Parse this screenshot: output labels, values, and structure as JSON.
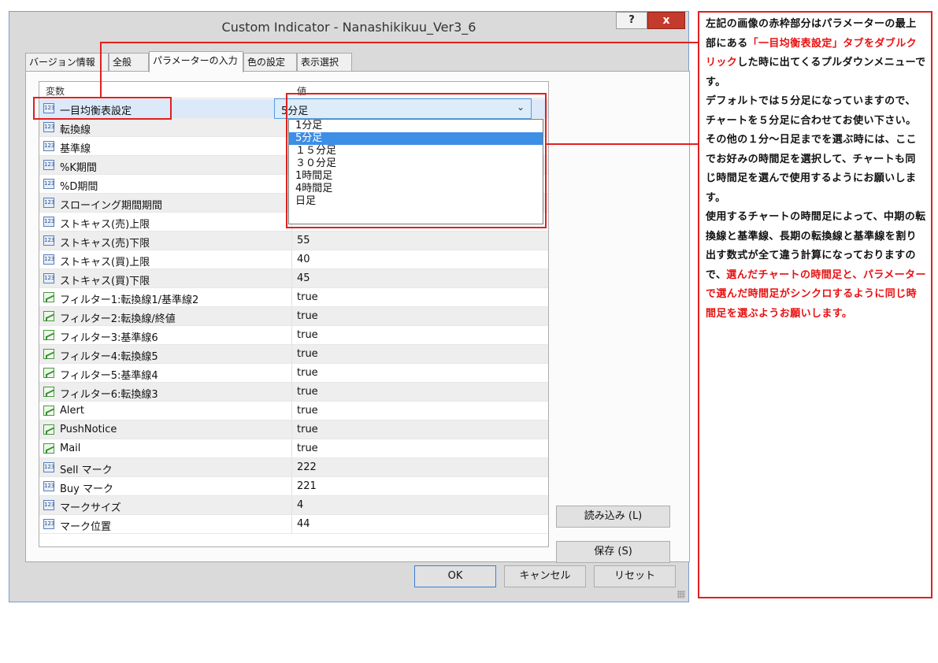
{
  "window": {
    "title": "Custom Indicator - Nanashikikuu_Ver3_6",
    "help_label": "?",
    "close_label": "x"
  },
  "tabs": [
    {
      "label": "バージョン情報"
    },
    {
      "label": "全般"
    },
    {
      "label": "パラメーターの入力"
    },
    {
      "label": "色の設定"
    },
    {
      "label": "表示選択"
    }
  ],
  "grid": {
    "col_name": "変数",
    "col_value": "値",
    "rows": [
      {
        "name": "一目均衡表設定",
        "value": "5分足",
        "type": "num"
      },
      {
        "name": "転換線",
        "value": "",
        "type": "num"
      },
      {
        "name": "基準線",
        "value": "",
        "type": "num"
      },
      {
        "name": "%K期間",
        "value": "",
        "type": "num"
      },
      {
        "name": "%D期間",
        "value": "",
        "type": "num"
      },
      {
        "name": "スローイング期間期間",
        "value": "",
        "type": "num"
      },
      {
        "name": "ストキャス(売)上限",
        "value": "",
        "type": "num"
      },
      {
        "name": "ストキャス(売)下限",
        "value": "55",
        "type": "num"
      },
      {
        "name": "ストキャス(買)上限",
        "value": "40",
        "type": "num"
      },
      {
        "name": "ストキャス(買)下限",
        "value": "45",
        "type": "num"
      },
      {
        "name": "フィルター1:転換線1/基準線2",
        "value": "true",
        "type": "bool"
      },
      {
        "name": "フィルター2:転換線/終値",
        "value": "true",
        "type": "bool"
      },
      {
        "name": "フィルター3:基準線6",
        "value": "true",
        "type": "bool"
      },
      {
        "name": "フィルター4:転換線5",
        "value": "true",
        "type": "bool"
      },
      {
        "name": "フィルター5:基準線4",
        "value": "true",
        "type": "bool"
      },
      {
        "name": "フィルター6:転換線3",
        "value": "true",
        "type": "bool"
      },
      {
        "name": "Alert",
        "value": "true",
        "type": "bool"
      },
      {
        "name": "PushNotice",
        "value": "true",
        "type": "bool"
      },
      {
        "name": "Mail",
        "value": "true",
        "type": "bool"
      },
      {
        "name": "Sell マーク",
        "value": "222",
        "type": "num"
      },
      {
        "name": "Buy マーク",
        "value": "221",
        "type": "num"
      },
      {
        "name": "マークサイズ",
        "value": "4",
        "type": "num"
      },
      {
        "name": "マーク位置",
        "value": "44",
        "type": "num"
      }
    ]
  },
  "combo": {
    "selected": "5分足",
    "options": [
      "1分足",
      "5分足",
      "１５分足",
      "３０分足",
      "1時間足",
      "4時間足",
      "日足"
    ],
    "highlighted_index": 1
  },
  "buttons": {
    "load": "読み込み (L)",
    "save": "保存 (S)",
    "ok": "OK",
    "cancel": "キャンセル",
    "reset": "リセット"
  },
  "note": {
    "segments": [
      {
        "text": "左記の画像の赤枠部分はパラメーターの最上部にある",
        "red": false
      },
      {
        "text": "「一目均衡表設定」タブをダブルクリック",
        "red": true
      },
      {
        "text": "した時に出てくるプルダウンメニューです。",
        "red": false
      },
      {
        "text": "デフォルトでは５分足になっていますので、チャートを５分足に合わせてお使い下さい。",
        "red": false,
        "newline": true
      },
      {
        "text": "その他の１分〜日足までを選ぶ時には、ここでお好みの時間足を選択して、チャートも同じ時間足を選んで使用するようにお願いします。",
        "red": false,
        "newline": true
      },
      {
        "text": "使用するチャートの時間足によって、中期の転換線と基準線、長期の転換線と基準線を割り出す数式が全て違う計算になっておりますので、",
        "red": false,
        "newline": true
      },
      {
        "text": "選んだチャートの時間足と、パラメーターで選んだ時間足がシンクロするように同じ時間足を選ぶようお願いします。",
        "red": true
      }
    ]
  },
  "colors": {
    "highlight_box": "#e02020",
    "selection": "#3d8ee6",
    "close_button": "#c43a2c"
  }
}
